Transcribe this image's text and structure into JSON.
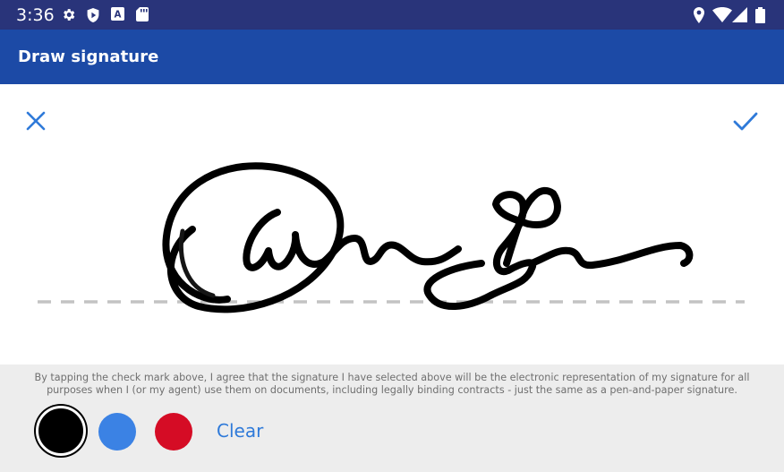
{
  "status_bar": {
    "time": "3:36",
    "left_icons": [
      "gear-icon",
      "shield-icon",
      "font-a-icon",
      "sd-card-icon"
    ],
    "right_icons": [
      "location-icon",
      "wifi-icon",
      "signal-icon",
      "battery-icon"
    ]
  },
  "app_bar": {
    "title": "Draw signature"
  },
  "canvas": {
    "cancel_icon": "close-icon",
    "confirm_icon": "check-icon",
    "signature_color": "#000000"
  },
  "footer": {
    "disclaimer": "By tapping the check mark above, I agree that the signature I have selected above will be the electronic representation of my signature for all purposes when I (or my agent) use them on documents, including legally binding contracts - just the same as a pen-and-paper signature.",
    "colors": [
      {
        "name": "black",
        "hex": "#000000",
        "selected": true
      },
      {
        "name": "blue",
        "hex": "#3b82e4",
        "selected": false
      },
      {
        "name": "red",
        "hex": "#d50c25",
        "selected": false
      }
    ],
    "clear_label": "Clear"
  },
  "theme": {
    "status_bar_bg": "#29347a",
    "app_bar_bg": "#1c4aa6",
    "accent": "#2f7ad9",
    "panel_bg": "#ededed",
    "baseline_color": "#c3c3c3"
  }
}
